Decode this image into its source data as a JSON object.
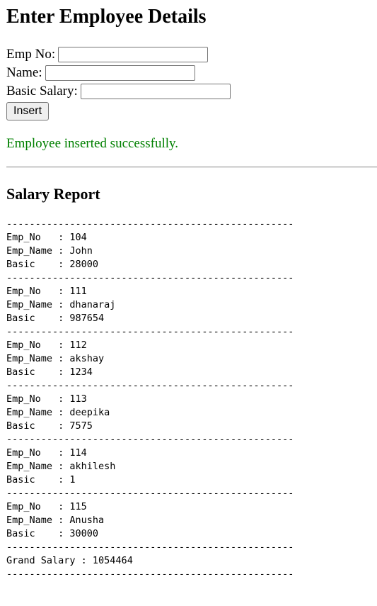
{
  "form": {
    "title": "Enter Employee Details",
    "emp_no_label": "Emp No:",
    "name_label": "Name:",
    "basic_label": "Basic Salary:",
    "emp_no_value": "",
    "name_value": "",
    "basic_value": "",
    "submit_label": "Insert"
  },
  "message": "Employee inserted successfully.",
  "report": {
    "title": "Salary Report",
    "rule": "--------------------------------------------------",
    "field_labels": {
      "emp_no": "Emp_No   : ",
      "emp_name": "Emp_Name : ",
      "basic": "Basic    : "
    },
    "employees": [
      {
        "emp_no": "104",
        "name": "John",
        "basic": "28000"
      },
      {
        "emp_no": "111",
        "name": "dhanaraj",
        "basic": "987654"
      },
      {
        "emp_no": "112",
        "name": "akshay",
        "basic": "1234"
      },
      {
        "emp_no": "113",
        "name": "deepika",
        "basic": "7575"
      },
      {
        "emp_no": "114",
        "name": "akhilesh",
        "basic": "1"
      },
      {
        "emp_no": "115",
        "name": "Anusha",
        "basic": "30000"
      }
    ],
    "grand_label": "Grand Salary : ",
    "grand_value": "1054464"
  }
}
